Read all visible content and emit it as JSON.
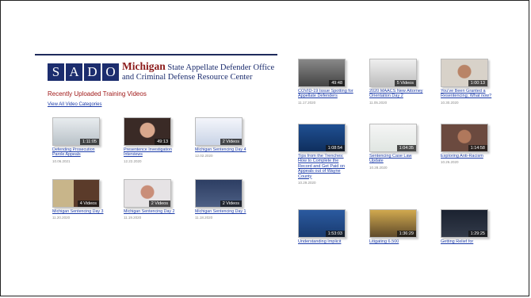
{
  "header": {
    "logo_letters": [
      "S",
      "A",
      "D",
      "O"
    ],
    "org_name_bold": "Michigan",
    "org_name_rest": "State Appellate Defender Office and Criminal Defense Resource Center"
  },
  "left": {
    "heading": "Recently Uploaded Training Videos",
    "view_all": "View All Video Categories",
    "videos": [
      {
        "title": "Defending Prosecution Parole Appeals",
        "date": "10.06.2021",
        "badge": "1:11:05"
      },
      {
        "title": "Presentence Investigation Interviews",
        "date": "12.22.2020",
        "badge": "49:13"
      },
      {
        "title": "Michigan Sentencing Day 4",
        "date": "12.02.2020",
        "badge": "2 Videos"
      },
      {
        "title": "Michigan Sentencing Day 3",
        "date": "11.20.2020",
        "badge": "4 Videos"
      },
      {
        "title": "Michigan Sentencing Day 2",
        "date": "11.19.2020",
        "badge": "2 Videos"
      },
      {
        "title": "Michigan Sentencing Day 1",
        "date": "11.18.2020",
        "badge": "2 Videos"
      }
    ]
  },
  "right": {
    "videos": [
      {
        "title": "COVID-19 Issue Spotting for Appellate Defenders",
        "date": "11.17.2020",
        "badge": "49:48"
      },
      {
        "title": "2020 MAACS New Attorney Orientation Day 2",
        "date": "11.05.2020",
        "badge": "5 Videos"
      },
      {
        "title": "You've Been Granted a Resentencing; What now?",
        "date": "10.30.2020",
        "badge": "1:00:13"
      },
      {
        "title": "Tips from the Trenches: How to Complete the Record and Get Paid on Appeals out of Wayne County",
        "date": "10.29.2020",
        "badge": "1:08:54"
      },
      {
        "title": "Sentencing Case Law Update",
        "date": "10.28.2020",
        "badge": "1:04:35"
      },
      {
        "title": "Exploring Anti-Racism",
        "date": "10.26.2020",
        "badge": "1:14:58"
      },
      {
        "title": "Understanding Implicit",
        "date": "",
        "badge": "1:53:03"
      },
      {
        "title": "Litigating 6.500",
        "date": "",
        "badge": "1:36:29"
      },
      {
        "title": "Getting Relief for",
        "date": "",
        "badge": "1:29:25"
      }
    ]
  },
  "colors": {
    "navy": "#1c2d6e",
    "maroon": "#8b1a1a",
    "link": "#1a3aa8"
  }
}
